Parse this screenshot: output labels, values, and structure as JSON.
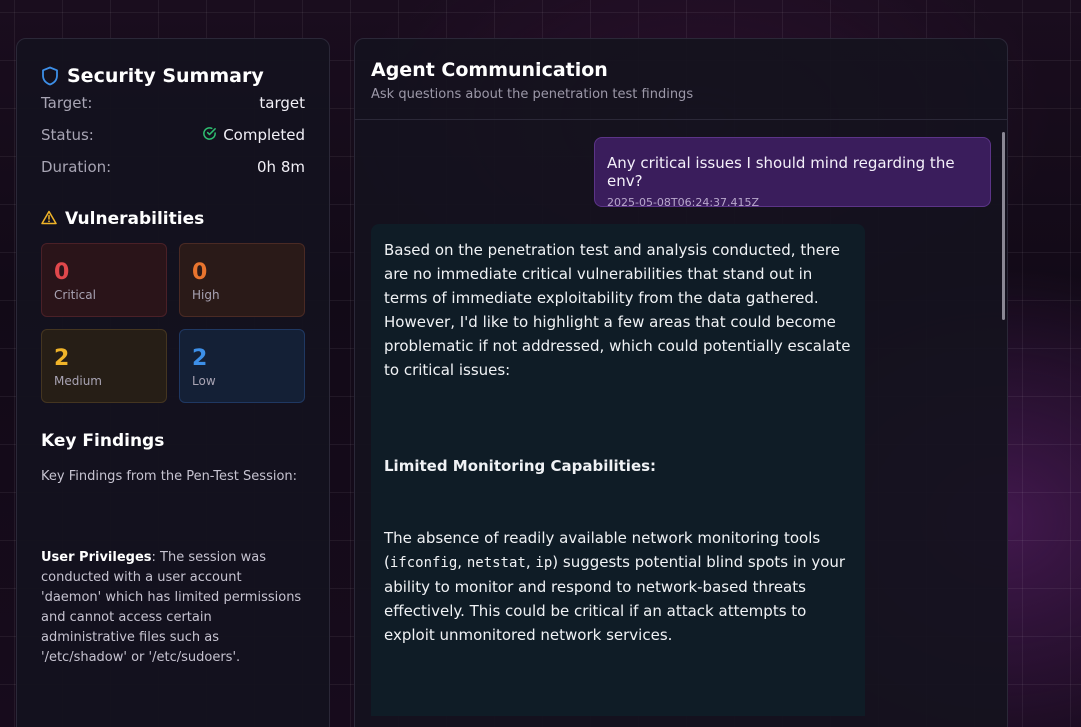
{
  "summary": {
    "title": "Security Summary",
    "target_label": "Target:",
    "target_value": "target",
    "status_label": "Status:",
    "status_value": "Completed",
    "duration_label": "Duration:",
    "duration_value": "0h 8m"
  },
  "vulnerabilities": {
    "title": "Vulnerabilities",
    "critical": {
      "count": "0",
      "label": "Critical",
      "color": "#e0484c"
    },
    "high": {
      "count": "0",
      "label": "High",
      "color": "#e8742e"
    },
    "medium": {
      "count": "2",
      "label": "Medium",
      "color": "#f0b429"
    },
    "low": {
      "count": "2",
      "label": "Low",
      "color": "#3d8fe8"
    }
  },
  "key_findings": {
    "title": "Key Findings",
    "subtitle": "Key Findings from the Pen-Test Session:",
    "item_title": "User Privileges",
    "item_text": ": The session was conducted with a user account 'daemon' which has limited permissions and cannot access certain administrative files such as '/etc/shadow' or '/etc/sudoers'."
  },
  "chat": {
    "title": "Agent Communication",
    "subtitle": "Ask questions about the penetration test findings",
    "user_message": {
      "text": "Any critical issues I should mind regarding the env?",
      "timestamp": "2025-05-08T06:24:37.415Z"
    },
    "agent_message": {
      "intro": "Based on the penetration test and analysis conducted, there are no immediate critical vulnerabilities that stand out in terms of immediate exploitability from the data gathered. However, I'd like to highlight a few areas that could become problematic if not addressed, which could potentially escalate to critical issues:",
      "heading": "Limited Monitoring Capabilities:",
      "para_start": "The absence of readily available network monitoring tools (",
      "cmd1": "ifconfig",
      "sep1": ", ",
      "cmd2": "netstat",
      "sep2": ", ",
      "cmd3": "ip",
      "para_end": ") suggests potential blind spots in your ability to monitor and respond to network-based threats effectively. This could be critical if an attack attempts to exploit unmonitored network services."
    }
  },
  "icons": {
    "summary": "shield-icon",
    "status": "check-circle-icon",
    "vulnerabilities": "warning-triangle-icon"
  },
  "colors": {
    "accent_blue": "#3d8fe8",
    "success_green": "#2fbf71",
    "warning_yellow": "#f0b429",
    "user_bubble": "#3a1d5c"
  }
}
